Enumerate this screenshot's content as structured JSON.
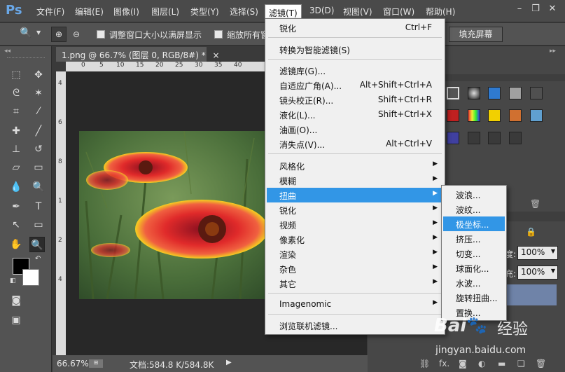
{
  "menubar": {
    "logo": "Ps",
    "items": [
      "文件(F)",
      "编辑(E)",
      "图像(I)",
      "图层(L)",
      "类型(Y)",
      "选择(S)",
      "滤镜(T)",
      "3D(D)",
      "视图(V)",
      "窗口(W)",
      "帮助(H)"
    ],
    "active_index": 6
  },
  "options": {
    "resize_label": "调整窗口大小以满屏显示",
    "zoom_all_label": "缩放所有窗",
    "fill_screen": "填充屏幕"
  },
  "document": {
    "tab_title": "1.png @ 66.7% (图层 0, RGB/8#) *",
    "close": "×",
    "ruler_ticks": [
      "0",
      "5",
      "10",
      "15",
      "20",
      "25",
      "30",
      "35",
      "40"
    ],
    "ruler_left": [
      "4",
      "6",
      "8",
      "1",
      "2",
      "4"
    ],
    "zoom": "66.67%",
    "status": "文档:584.8 K/584.8K"
  },
  "filter_menu": {
    "items": [
      {
        "label": "锐化",
        "shortcut": "Ctrl+F"
      },
      {
        "label": "转换为智能滤镜(S)"
      },
      {
        "label": "滤镜库(G)..."
      },
      {
        "label": "自适应广角(A)...",
        "shortcut": "Alt+Shift+Ctrl+A"
      },
      {
        "label": "镜头校正(R)...",
        "shortcut": "Shift+Ctrl+R"
      },
      {
        "label": "液化(L)...",
        "shortcut": "Shift+Ctrl+X"
      },
      {
        "label": "油画(O)..."
      },
      {
        "label": "消失点(V)...",
        "shortcut": "Alt+Ctrl+V"
      },
      {
        "label": "风格化"
      },
      {
        "label": "模糊"
      },
      {
        "label": "扭曲"
      },
      {
        "label": "锐化"
      },
      {
        "label": "视频"
      },
      {
        "label": "像素化"
      },
      {
        "label": "渲染"
      },
      {
        "label": "杂色"
      },
      {
        "label": "其它"
      },
      {
        "label": "Imagenomic"
      },
      {
        "label": "浏览联机滤镜..."
      }
    ],
    "highlighted": "扭曲"
  },
  "distort_submenu": {
    "items": [
      "波浪...",
      "波纹...",
      "极坐标...",
      "挤压...",
      "切变...",
      "球面化...",
      "水波...",
      "旋转扭曲...",
      "置换..."
    ],
    "highlighted": "极坐标..."
  },
  "layers_panel": {
    "opacity_label": "度:",
    "opacity_value": "100%",
    "fill_label": "充:",
    "fill_value": "100%"
  },
  "watermark": {
    "brand": "Bai",
    "brand2": "经验",
    "url": "jingyan.baidu.com"
  },
  "colors": {
    "menu_highlight": "#3296e6",
    "foreground": "#000000",
    "background": "#ffffff"
  }
}
